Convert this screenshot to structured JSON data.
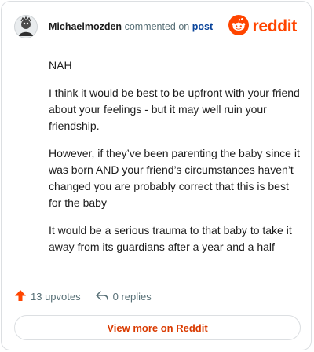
{
  "comment": {
    "username": "Michaelmozden",
    "action_text": "commented on",
    "post_link": "post",
    "paragraphs": [
      "NAH",
      "I think it would be best to be upfront with your friend about your feelings - but it may well ruin your friendship.",
      "However, if they’ve been parenting the baby since it was born AND your friend’s circumstances haven’t changed you are probably correct that this is best for the baby",
      "It would be a serious trauma to that baby to take it away from its guardians after a year and a half"
    ]
  },
  "brand": {
    "name": "reddit",
    "color": "#ff4500"
  },
  "footer": {
    "upvotes": "13 upvotes",
    "replies": "0 replies",
    "view_more": "View more on Reddit"
  },
  "icons": {
    "avatar": "avatar-icon",
    "logo": "reddit-snoo-icon",
    "upvote": "upvote-arrow-icon",
    "reply": "reply-arrow-icon"
  }
}
